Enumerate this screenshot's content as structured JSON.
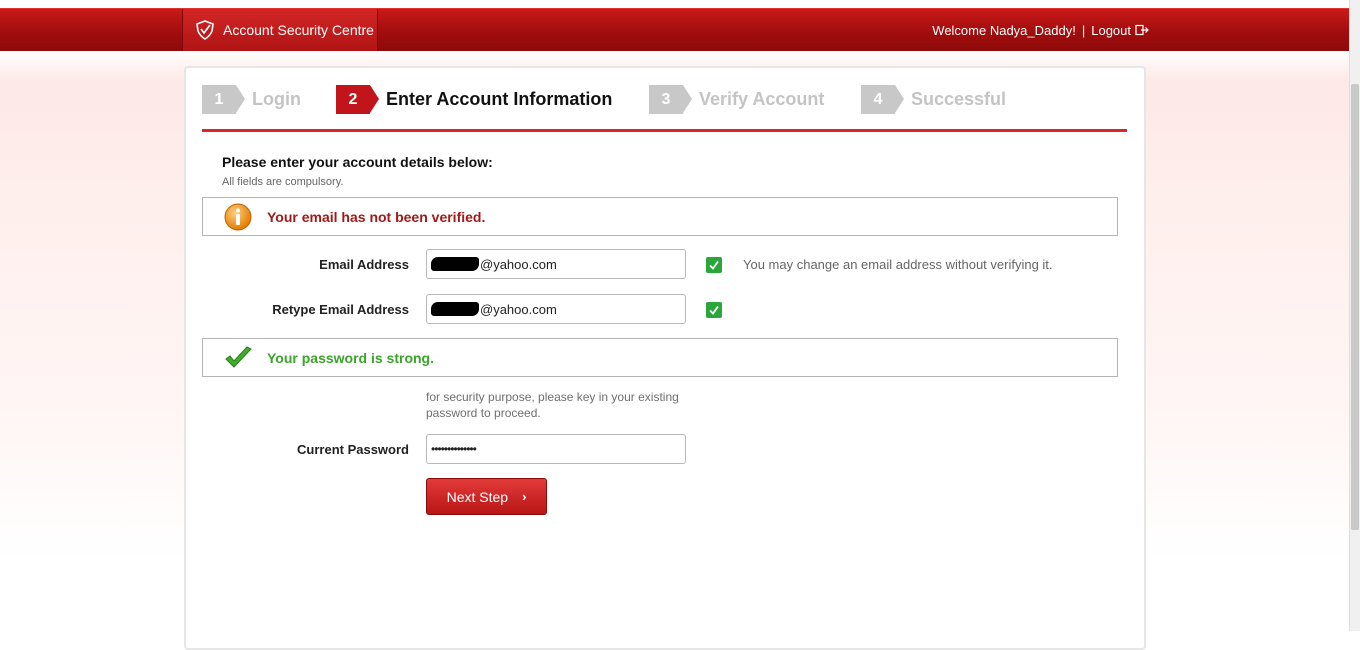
{
  "header": {
    "brand": "Account Security Centre",
    "welcome": "Welcome Nadya_Daddy!",
    "separator": "|",
    "logout": "Logout"
  },
  "steps": [
    {
      "num": "1",
      "label": "Login",
      "active": false
    },
    {
      "num": "2",
      "label": "Enter Account Information",
      "active": true
    },
    {
      "num": "3",
      "label": "Verify Account",
      "active": false
    },
    {
      "num": "4",
      "label": "Successful",
      "active": false
    }
  ],
  "form": {
    "intro": "Please enter your account details below:",
    "note": "All fields are compulsory.",
    "email_warning": "Your email has not been verified.",
    "email_label": "Email Address",
    "email_value": "@yahoo.com",
    "email_hint": "You may change an email address without verifying it.",
    "retype_label": "Retype Email Address",
    "retype_value": "@yahoo.com",
    "password_status": "Your password is strong.",
    "password_note": "for security purpose, please key in your existing password to proceed.",
    "password_label": "Current Password",
    "password_value": "••••••••••••••",
    "next_button": "Next Step",
    "next_chevron": "›"
  },
  "colors": {
    "brand_red": "#b01414",
    "active_step": "#c1141b",
    "inactive_step": "#c8c8c8",
    "success_green": "#3aa52a",
    "warning_red": "#a11a1a"
  }
}
